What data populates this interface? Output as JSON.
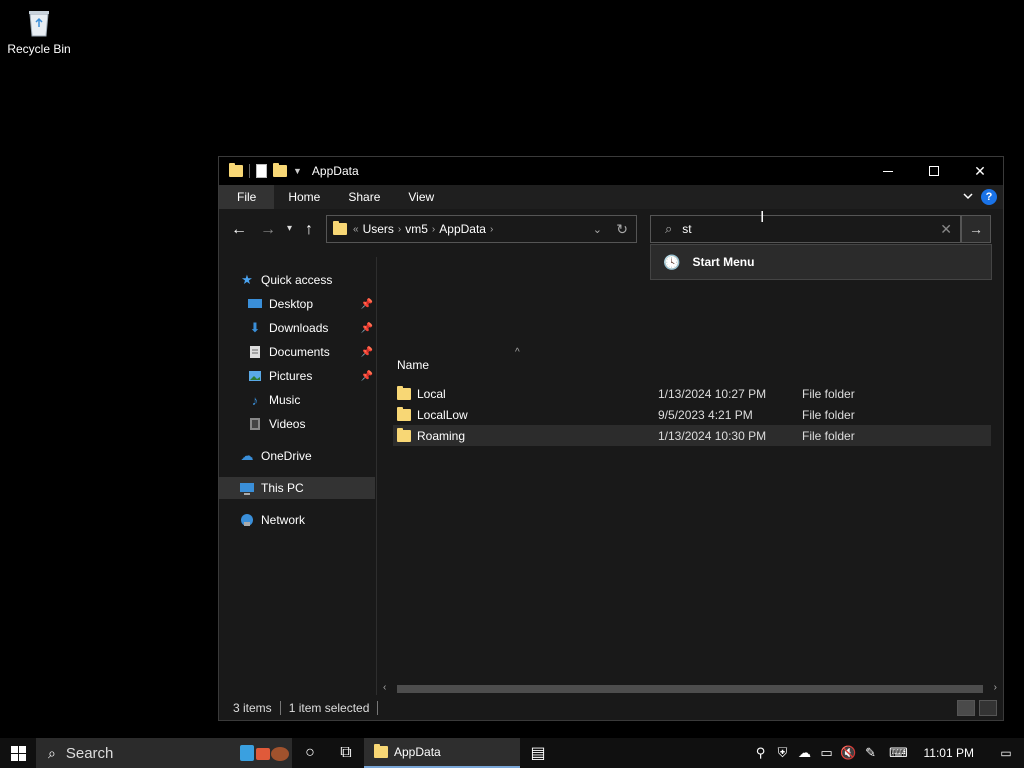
{
  "desktop": {
    "recycle_bin_label": "Recycle Bin"
  },
  "window": {
    "title": "AppData",
    "ribbon_tabs": [
      "File",
      "Home",
      "Share",
      "View"
    ],
    "address": {
      "overflow": "«",
      "crumbs": [
        "Users",
        "vm5",
        "AppData"
      ]
    },
    "search": {
      "value": "st",
      "suggestion": "Start Menu"
    },
    "nav_pane": {
      "quick_access": "Quick access",
      "items": [
        {
          "label": "Desktop",
          "icon": "desktop-icon",
          "pinned": true
        },
        {
          "label": "Downloads",
          "icon": "download-icon",
          "pinned": true
        },
        {
          "label": "Documents",
          "icon": "document-icon",
          "pinned": true
        },
        {
          "label": "Pictures",
          "icon": "pictures-icon",
          "pinned": true
        },
        {
          "label": "Music",
          "icon": "music-icon",
          "pinned": false
        },
        {
          "label": "Videos",
          "icon": "video-icon",
          "pinned": false
        }
      ],
      "onedrive": "OneDrive",
      "this_pc": "This PC",
      "network": "Network"
    },
    "columns": {
      "name": "Name"
    },
    "files": [
      {
        "name": "Local",
        "date": "1/13/2024 10:27 PM",
        "type": "File folder"
      },
      {
        "name": "LocalLow",
        "date": "9/5/2023 4:21 PM",
        "type": "File folder"
      },
      {
        "name": "Roaming",
        "date": "1/13/2024 10:30 PM",
        "type": "File folder",
        "selected": true
      }
    ],
    "status": {
      "items": "3 items",
      "selected": "1 item selected"
    }
  },
  "taskbar": {
    "search_placeholder": "Search",
    "app_label": "AppData",
    "clock": "11:01 PM"
  },
  "colors": {
    "accent": "#7aa7d8",
    "folder": "#f8d775",
    "help": "#1a73e8"
  }
}
